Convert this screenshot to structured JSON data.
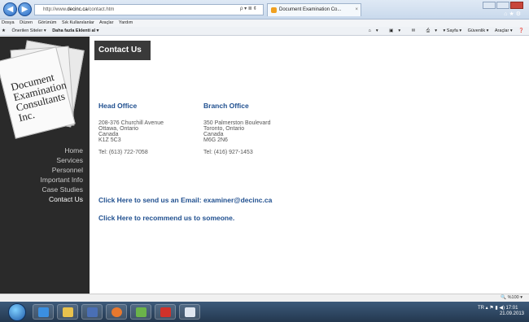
{
  "browser": {
    "address": "http://www.decinc.ca/contact.htm",
    "address_prefix": "http://www.",
    "address_domain": "decinc.ca",
    "address_path": "/contact.htm",
    "address_controls": "ρ ▾ ≣ ¢",
    "tab_title": "Document Examination Co...",
    "menu": [
      "Dosya",
      "Düzen",
      "Görünüm",
      "Sık Kullanılanlar",
      "Araçlar",
      "Yardım"
    ],
    "favorites": {
      "suggested": "Önerilen Siteler ▾",
      "more": "Daha fazla Eklenti al ▾"
    },
    "commands": [
      "▾",
      "▾",
      "▾",
      "▾ Sayfa ▾",
      "Güvenlik ▾",
      "Araçlar ▾"
    ]
  },
  "logo": {
    "line1": "Document",
    "line2": "Examination",
    "line3": "Consultants",
    "line4": "Inc."
  },
  "nav": [
    "Home",
    "Services",
    "Personnel",
    "Important Info",
    "Case Studies",
    "Contact Us"
  ],
  "nav_active": "Contact Us",
  "page_title": "Contact Us",
  "head_office": {
    "heading": "Head Office",
    "lines": [
      "208-376 Churchill Avenue",
      "Ottawa, Ontario",
      "Canada",
      "K1Z 5C3"
    ],
    "tel": "Tel: (613) 722-7058"
  },
  "branch_office": {
    "heading": "Branch Office",
    "lines": [
      "350 Palmerston Boulevard",
      "Toronto, Ontario",
      "Canada",
      "M6G 2N6"
    ],
    "tel": "Tel: (416) 927-1453"
  },
  "email_link": "Click Here to send us an Email: examiner@decinc.ca",
  "recommend_link": "Click Here to recommend us to someone.",
  "status": {
    "zoom": "%100 ▾"
  },
  "taskbar": {
    "lang": "TR",
    "time": "17:01",
    "date": "21.09.2013"
  },
  "colors": {
    "link": "#1f4f8f",
    "sidebar": "#2a2a2a"
  }
}
